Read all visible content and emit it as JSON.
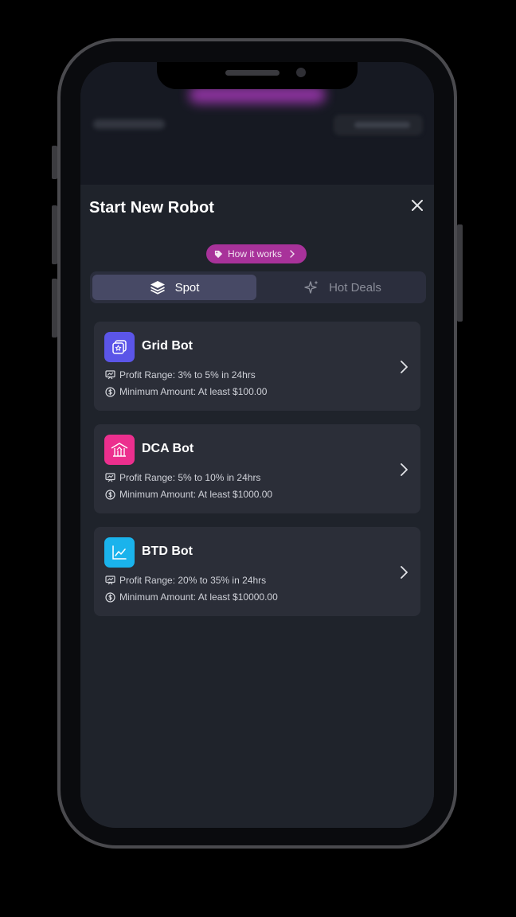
{
  "sheet": {
    "title": "Start New Robot",
    "how_it_works_label": "How it works"
  },
  "tabs": [
    {
      "label": "Spot",
      "active": true,
      "icon": "layers-icon"
    },
    {
      "label": "Hot Deals",
      "active": false,
      "icon": "sparkles-icon"
    }
  ],
  "bots": [
    {
      "name": "Grid Bot",
      "icon": "grid-bot-icon",
      "icon_color": "#5b55e8",
      "profit_range": "Profit Range: 3% to 5% in 24hrs",
      "minimum_amount": "Minimum Amount: At least $100.00"
    },
    {
      "name": "DCA Bot",
      "icon": "dca-bot-icon",
      "icon_color": "#ec2f8e",
      "profit_range": "Profit Range: 5% to 10% in 24hrs",
      "minimum_amount": "Minimum Amount: At least $1000.00"
    },
    {
      "name": "BTD Bot",
      "icon": "btd-bot-icon",
      "icon_color": "#1ab3ec",
      "profit_range": "Profit Range: 20% to 35% in 24hrs",
      "minimum_amount": "Minimum Amount: At least $10000.00"
    }
  ],
  "colors": {
    "accent_pill": "#a8329a",
    "active_tab": "#474965",
    "sheet_bg": "#1f232b",
    "card_bg": "#2b2e38"
  }
}
